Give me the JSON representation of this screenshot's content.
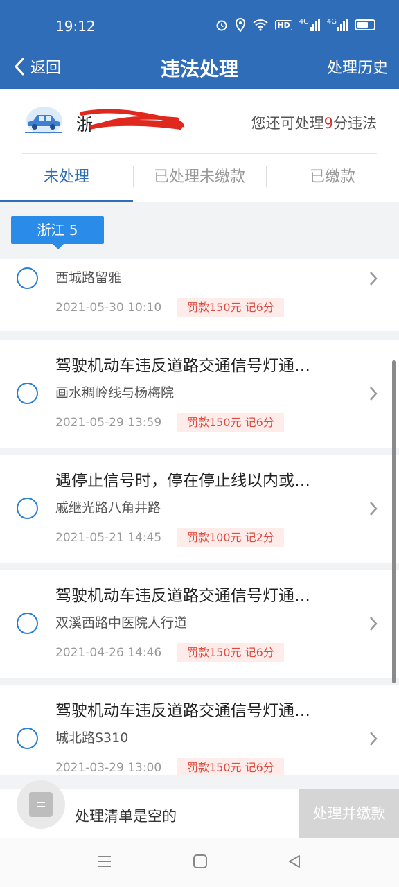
{
  "status_bar": {
    "time": "19:12",
    "hd_label": "HD",
    "net1": "4G",
    "net2": "4G",
    "icons": [
      "alarm-icon",
      "location-icon",
      "wifi-icon",
      "hd-icon",
      "signal-icon",
      "signal-icon",
      "battery-icon"
    ]
  },
  "navbar": {
    "back_label": "返回",
    "title": "违法处理",
    "history_label": "处理历史"
  },
  "car": {
    "plate_prefix": "浙",
    "quota_prefix": "您还可处理",
    "quota_points": "9",
    "quota_suffix": "分违法"
  },
  "tabs": [
    {
      "label": "未处理",
      "active": true
    },
    {
      "label": "已处理未缴款",
      "active": false
    },
    {
      "label": "已缴款",
      "active": false
    }
  ],
  "region_badge": "浙江 5",
  "violations": [
    {
      "title": "",
      "location": "西城路留雅",
      "datetime": "2021-05-30 10:10",
      "fine": "罚款150元 记6分"
    },
    {
      "title": "驾驶机动车违反道路交通信号灯通…",
      "location": "画水稠岭线与杨梅院",
      "datetime": "2021-05-29 13:59",
      "fine": "罚款150元 记6分"
    },
    {
      "title": "遇停止信号时，停在停止线以内或…",
      "location": "戚继光路八角井路",
      "datetime": "2021-05-21 14:45",
      "fine": "罚款100元 记2分"
    },
    {
      "title": "驾驶机动车违反道路交通信号灯通…",
      "location": "双溪西路中医院人行道",
      "datetime": "2021-04-26 14:46",
      "fine": "罚款150元 记6分"
    },
    {
      "title": "驾驶机动车违反道路交通信号灯通…",
      "location": "城北路S310",
      "datetime": "2021-03-29 13:00",
      "fine": "罚款150元 记6分"
    }
  ],
  "bottom": {
    "empty_label": "处理清单是空的",
    "pay_label": "处理并缴款"
  },
  "colors": {
    "primary": "#2f6db8",
    "accent": "#2a8ce8",
    "fine_text": "#e04a3f",
    "fine_bg": "#fdecea",
    "points_red": "#d6332f"
  }
}
